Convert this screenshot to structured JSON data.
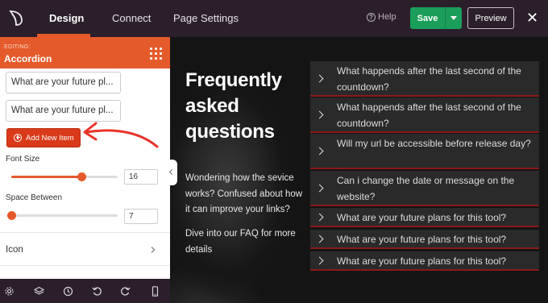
{
  "topbar": {
    "tabs": [
      {
        "label": "Design",
        "active": true
      },
      {
        "label": "Connect",
        "active": false
      },
      {
        "label": "Page Settings",
        "active": false
      }
    ],
    "help_label": "Help",
    "save_label": "Save",
    "preview_label": "Preview",
    "close_symbol": "✕"
  },
  "sidebar": {
    "editing_label": "EDITING:",
    "module_title": "Accordion",
    "items": [
      {
        "value": "What are your future pl..."
      },
      {
        "value": "What are your future pl..."
      }
    ],
    "add_item_label": "Add New Item",
    "font_size": {
      "label": "Font Size",
      "value": "16",
      "level": 0.66
    },
    "space_between": {
      "label": "Space Between",
      "value": "7",
      "level": 0.0
    },
    "icon_row_label": "Icon"
  },
  "canvas": {
    "title": "Frequently asked questions",
    "description": "Wondering how the sevice works? Confused about how it can improve your links?",
    "cta": "Dive into our FAQ for more details",
    "questions": [
      "What happends after the last second of the countdown?",
      "What happends after the last second of the countdown?",
      "Will my url be accessible before release day?",
      "Can i change the date or message on the website?",
      "What are your future plans for this tool?",
      "What are your future plans for this tool?",
      "What are your future plans for this tool?"
    ]
  },
  "colors": {
    "topbar_bg": "#2b1f2b",
    "accent_orange": "#e55a2b",
    "add_button_red": "#d93a1a",
    "save_green": "#1a9e5a",
    "accordion_border": "#8b1a1a",
    "annotation_arrow": "#e8342a"
  },
  "icons": {
    "logo": "seedprod-leaf-icon",
    "help": "question-circle-icon",
    "grid": "grid-dots-icon",
    "plus": "plus-circle-icon",
    "chevron": "chevron-right-icon",
    "bottombar": [
      "gear-icon",
      "layers-icon",
      "history-icon",
      "undo-icon",
      "redo-icon",
      "mobile-preview-icon"
    ]
  }
}
